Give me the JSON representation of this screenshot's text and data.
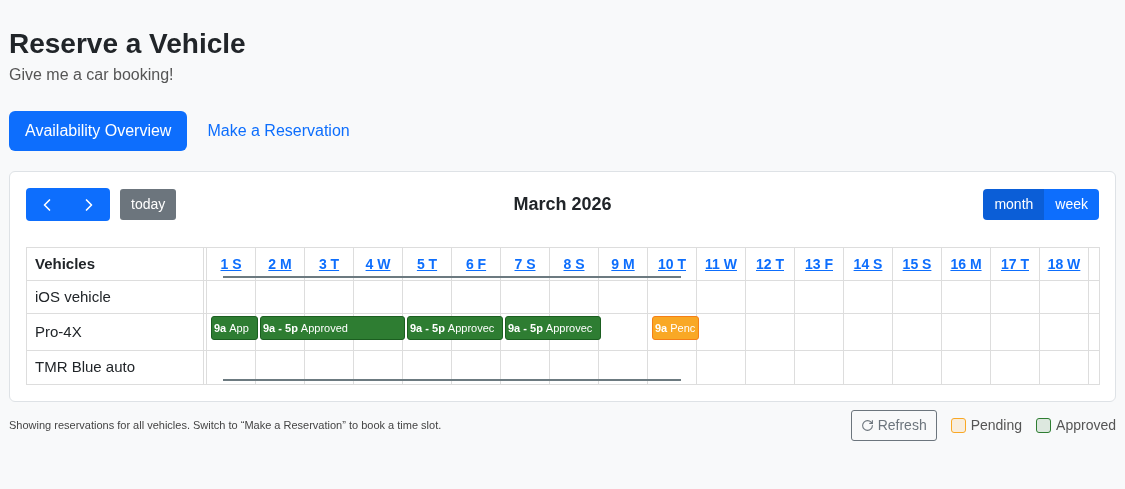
{
  "header": {
    "title": "Reserve a Vehicle",
    "subtitle": "Give me a car booking!"
  },
  "tabs": [
    {
      "label": "Availability Overview",
      "selected": true
    },
    {
      "label": "Make a Reservation",
      "selected": false
    }
  ],
  "calendar": {
    "today_button": "today",
    "title": "March 2026",
    "views": [
      {
        "label": "month",
        "selected": true
      },
      {
        "label": "week",
        "selected": false
      }
    ],
    "resource_header": "Vehicles",
    "days": [
      "1 S",
      "2 M",
      "3 T",
      "4 W",
      "5 T",
      "6 F",
      "7 S",
      "8 S",
      "9 M",
      "10 T",
      "11 W",
      "12 T",
      "13 F",
      "14 S",
      "15 S",
      "16 M",
      "17 T",
      "18 W"
    ],
    "vehicles": [
      {
        "name": "iOS vehicle"
      },
      {
        "name": "Pro-4X",
        "slots": [
          {
            "kind": "approved",
            "time": "9a",
            "label": "App"
          },
          {
            "kind": "approved",
            "time": "9a - 5p",
            "label": "Approved"
          },
          {
            "kind": "continued"
          },
          {
            "kind": "continued"
          },
          {
            "kind": "approved",
            "time": "9a - 5p",
            "label": "Approvec"
          },
          {
            "kind": "continued"
          },
          {
            "kind": "approved",
            "time": "9a - 5p",
            "label": "Approvec"
          },
          {
            "kind": "continued"
          },
          {
            "kind": "empty"
          },
          {
            "kind": "pending",
            "time": "9a",
            "label": "Penc"
          }
        ]
      },
      {
        "name": "TMR Blue auto"
      }
    ]
  },
  "footer": {
    "note": "Showing reservations for all vehicles. Switch to “Make a Reservation” to book a time slot.",
    "refresh": "Refresh",
    "legend": [
      {
        "label": "Pending",
        "color": "#f9a825"
      },
      {
        "label": "Approved",
        "color": "#2e7d32"
      }
    ]
  }
}
